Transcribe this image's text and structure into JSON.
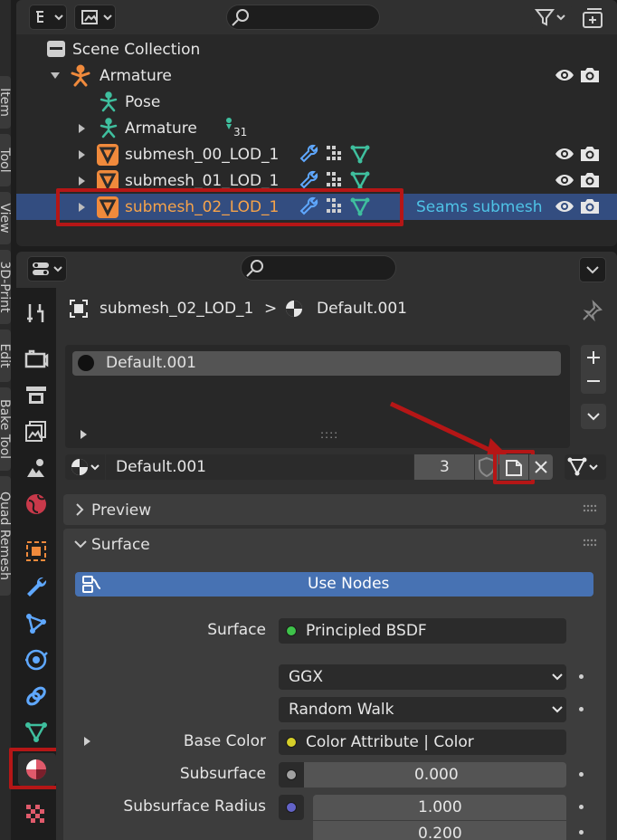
{
  "left_tabs": [
    "Item",
    "Tool",
    "View",
    "3D-Print",
    "Edit",
    "Bake Tool",
    "Quad Remesh"
  ],
  "outliner": {
    "rows": [
      {
        "label": "Scene Collection"
      },
      {
        "label": "Armature"
      },
      {
        "label": "Pose"
      },
      {
        "label": "Armature",
        "badge": "31"
      },
      {
        "label": "submesh_00_LOD_1"
      },
      {
        "label": "submesh_01_LOD_1"
      },
      {
        "label": "submesh_02_LOD_1",
        "note": "Seams submesh"
      }
    ]
  },
  "properties": {
    "breadcrumb": {
      "object": "submesh_02_LOD_1",
      "separator": ">",
      "material": "Default.001"
    },
    "material_slots": [
      {
        "name": "Default.001"
      }
    ],
    "list_grip": "::::",
    "datablock": {
      "name": "Default.001",
      "users": "3"
    },
    "preview_panel": {
      "label": "Preview"
    },
    "surface_panel": {
      "label": "Surface",
      "use_nodes_label": "Use Nodes",
      "surface_label": "Surface",
      "surface_value": "Principled BSDF",
      "distribution": "GGX",
      "subsurface_method": "Random Walk",
      "base_color_label": "Base Color",
      "base_color_value": "Color Attribute | Color",
      "subsurface_label": "Subsurface",
      "subsurface_value": "0.000",
      "subsurface_radius_label": "Subsurface Radius",
      "subsurface_radius_values": [
        "1.000",
        "0.200"
      ]
    }
  },
  "colors": {
    "selection": "#334d80",
    "highlight_box": "#b51616",
    "object_orange": "#f6a34a",
    "armature_teal": "#3fbf9e",
    "modifier_blue": "#5fa8ff",
    "note_cyan": "#4fc3e6",
    "use_nodes_blue": "#4772b3"
  },
  "icons": [
    "outliner-display-mode-icon",
    "filter-icon",
    "new-collection-icon",
    "search-icon",
    "collection-icon",
    "armature-icon",
    "pose-icon",
    "mesh-triangle-icon",
    "wrench-modifier-icon",
    "lattice-icon",
    "vertex-group-icon",
    "eye-icon",
    "camera-icon",
    "pin-icon",
    "material-icon",
    "fake-user-shield-icon",
    "new-material-copy-icon",
    "close-icon",
    "tool-tab-icon",
    "render-tab-icon",
    "output-tab-icon",
    "view-layer-tab-icon",
    "scene-tab-icon",
    "world-tab-icon",
    "object-tab-icon",
    "modifier-tab-icon",
    "particles-tab-icon",
    "physics-tab-icon",
    "constraints-tab-icon",
    "data-tab-icon",
    "material-tab-icon",
    "texture-tab-icon"
  ]
}
